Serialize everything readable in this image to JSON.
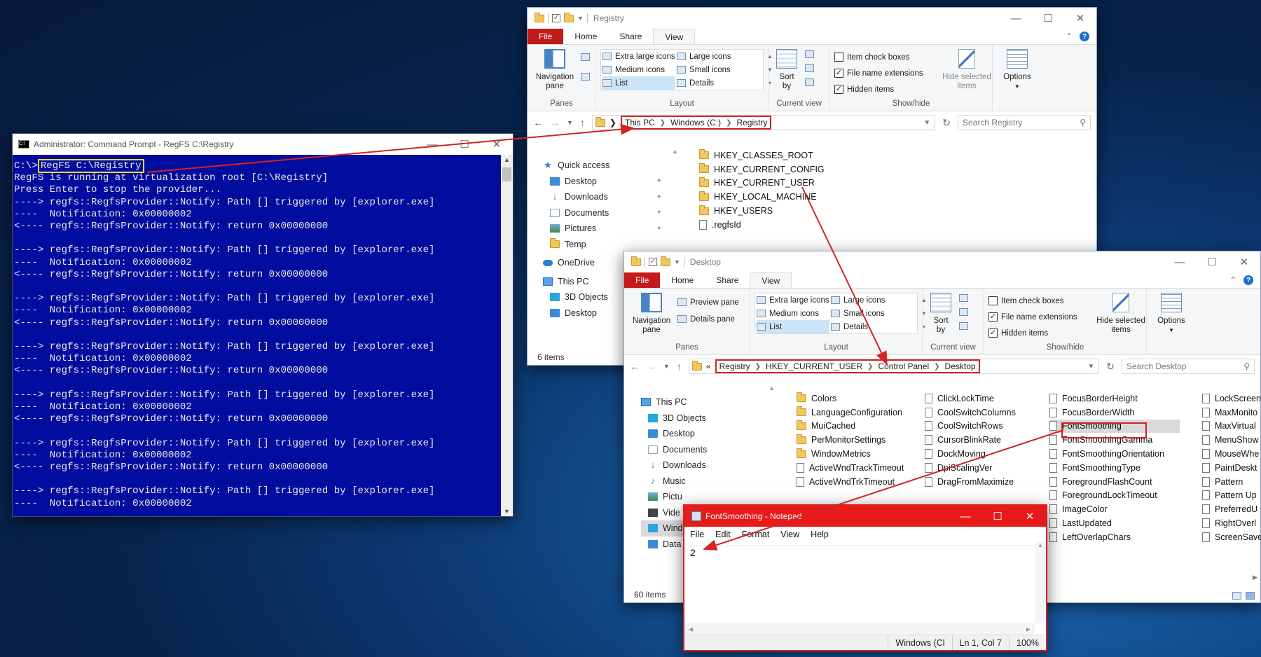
{
  "colors": {
    "file_tab": "#c41a1a",
    "cmd_bg": "#000d9e",
    "annotation": "#d32323",
    "highlight": "#f2d63a",
    "selection": "#cce4f7"
  },
  "cmd": {
    "title": "Administrator: Command Prompt - RegFS  C:\\Registry",
    "prompt": "C:\\>",
    "command": "RegFS C:\\Registry",
    "lines": [
      "RegFS is running at virtualization root [C:\\Registry]",
      "Press Enter to stop the provider...",
      "----> regfs::RegfsProvider::Notify: Path [] triggered by [explorer.exe]",
      "----  Notification: 0x00000002",
      "<---- regfs::RegfsProvider::Notify: return 0x00000000",
      "",
      "----> regfs::RegfsProvider::Notify: Path [] triggered by [explorer.exe]",
      "----  Notification: 0x00000002",
      "<---- regfs::RegfsProvider::Notify: return 0x00000000",
      "",
      "----> regfs::RegfsProvider::Notify: Path [] triggered by [explorer.exe]",
      "----  Notification: 0x00000002",
      "<---- regfs::RegfsProvider::Notify: return 0x00000000",
      "",
      "----> regfs::RegfsProvider::Notify: Path [] triggered by [explorer.exe]",
      "----  Notification: 0x00000002",
      "<---- regfs::RegfsProvider::Notify: return 0x00000000",
      "",
      "----> regfs::RegfsProvider::Notify: Path [] triggered by [explorer.exe]",
      "----  Notification: 0x00000002",
      "<---- regfs::RegfsProvider::Notify: return 0x00000000",
      "",
      "----> regfs::RegfsProvider::Notify: Path [] triggered by [explorer.exe]",
      "----  Notification: 0x00000002",
      "<---- regfs::RegfsProvider::Notify: return 0x00000000",
      "",
      "----> regfs::RegfsProvider::Notify: Path [] triggered by [explorer.exe]",
      "----  Notification: 0x00000002"
    ]
  },
  "explorer1": {
    "title": "Registry",
    "tabs": [
      "File",
      "Home",
      "Share",
      "View"
    ],
    "ribbon": {
      "nav_pane": "Navigation pane",
      "panes_label": "Panes",
      "layout_options": [
        "Extra large icons",
        "Large icons",
        "Medium icons",
        "Small icons",
        "List",
        "Details"
      ],
      "layout_label": "Layout",
      "sort_by": "Sort by",
      "current_view_label": "Current view",
      "item_check_boxes": "Item check boxes",
      "file_name_extensions": "File name extensions",
      "hidden_items": "Hidden items",
      "hide_selected": "Hide selected items",
      "showhide_label": "Show/hide",
      "options": "Options"
    },
    "breadcrumb": [
      "This PC",
      "Windows (C:)",
      "Registry"
    ],
    "search_placeholder": "Search Registry",
    "nav": [
      "Quick access",
      "Desktop",
      "Downloads",
      "Documents",
      "Pictures",
      "Temp",
      "OneDrive",
      "This PC",
      "3D Objects",
      "Desktop"
    ],
    "files": [
      "HKEY_CLASSES_ROOT",
      "HKEY_CURRENT_CONFIG",
      "HKEY_CURRENT_USER",
      "HKEY_LOCAL_MACHINE",
      "HKEY_USERS",
      ".regfsId"
    ],
    "status": "6 items"
  },
  "explorer2": {
    "title": "Desktop",
    "tabs": [
      "File",
      "Home",
      "Share",
      "View"
    ],
    "ribbon": {
      "nav_pane": "Navigation pane",
      "preview_pane": "Preview pane",
      "details_pane": "Details pane",
      "panes_label": "Panes",
      "layout_options": [
        "Extra large icons",
        "Large icons",
        "Medium icons",
        "Small icons",
        "List",
        "Details"
      ],
      "layout_label": "Layout",
      "sort_by": "Sort by",
      "current_view_label": "Current view",
      "item_check_boxes": "Item check boxes",
      "file_name_extensions": "File name extensions",
      "hidden_items": "Hidden items",
      "hide_selected": "Hide selected items",
      "showhide_label": "Show/hide",
      "options": "Options"
    },
    "breadcrumb": [
      "Registry",
      "HKEY_CURRENT_USER",
      "Control Panel",
      "Desktop"
    ],
    "search_placeholder": "Search Desktop",
    "nav": [
      "This PC",
      "3D Objects",
      "Desktop",
      "Documents",
      "Downloads",
      "Music",
      "Pictu",
      "Vide",
      "Wind",
      "Data"
    ],
    "col1": [
      "Colors",
      "LanguageConfiguration",
      "MuiCached",
      "PerMonitorSettings",
      "WindowMetrics",
      "ActiveWndTrackTimeout",
      "ActiveWndTrkTimeout"
    ],
    "col2": [
      "ClickLockTime",
      "CoolSwitchColumns",
      "CoolSwitchRows",
      "CursorBlinkRate",
      "DockMoving",
      "DpiScalingVer",
      "DragFromMaximize"
    ],
    "col3": [
      "FocusBorderHeight",
      "FocusBorderWidth",
      "FontSmoothing",
      "FontSmoothingGamma",
      "FontSmoothingOrientation",
      "FontSmoothingType",
      "ForegroundFlashCount",
      "ForegroundLockTimeout",
      "ImageColor",
      "LastUpdated",
      "LeftOverlapChars"
    ],
    "col4": [
      "LockScreen",
      "MaxMonito",
      "MaxVirtual",
      "MenuShow",
      "MouseWhe",
      "PaintDeskt",
      "Pattern",
      "Pattern Up",
      "PreferredU",
      "RightOverl",
      "ScreenSave"
    ],
    "status": "60 items"
  },
  "notepad": {
    "title": "FontSmoothing - Notepad",
    "menu": [
      "File",
      "Edit",
      "Format",
      "View",
      "Help"
    ],
    "content": "2",
    "status": [
      "Windows (Cl",
      "Ln 1, Col 7",
      "100%"
    ]
  }
}
